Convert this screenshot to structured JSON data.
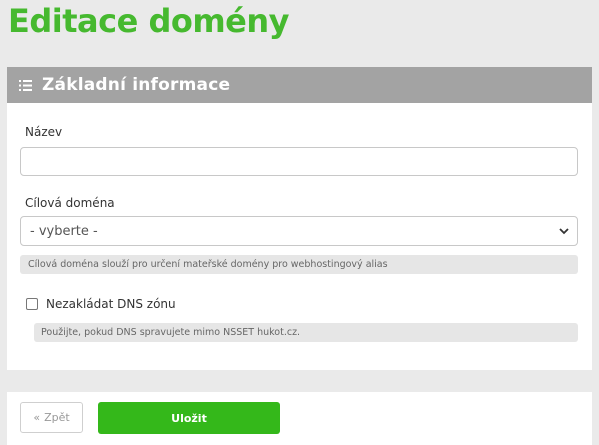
{
  "page": {
    "title": "Editace domény"
  },
  "panel": {
    "icon": "list-icon",
    "title": "Základní informace"
  },
  "fields": {
    "name": {
      "label": "Název",
      "value": "",
      "placeholder": ""
    },
    "target_domain": {
      "label": "Cílová doména",
      "selected": "- vyberte -",
      "help": "Cílová doména slouží pro určení mateřské domény pro webhostingový alias"
    },
    "no_dns_zone": {
      "label": "Nezakládat DNS zónu",
      "checked": false,
      "help": "Použijte, pokud DNS spravujete mimo NSSET hukot.cz."
    }
  },
  "footer": {
    "back_icon": "double-chevron-left-icon",
    "back_label": "Zpět",
    "save_label": "Uložit"
  },
  "colors": {
    "brand_green": "#46b92f",
    "save_button": "#34b81a",
    "panel_header": "#a3a3a3",
    "background": "#eaeaea"
  }
}
